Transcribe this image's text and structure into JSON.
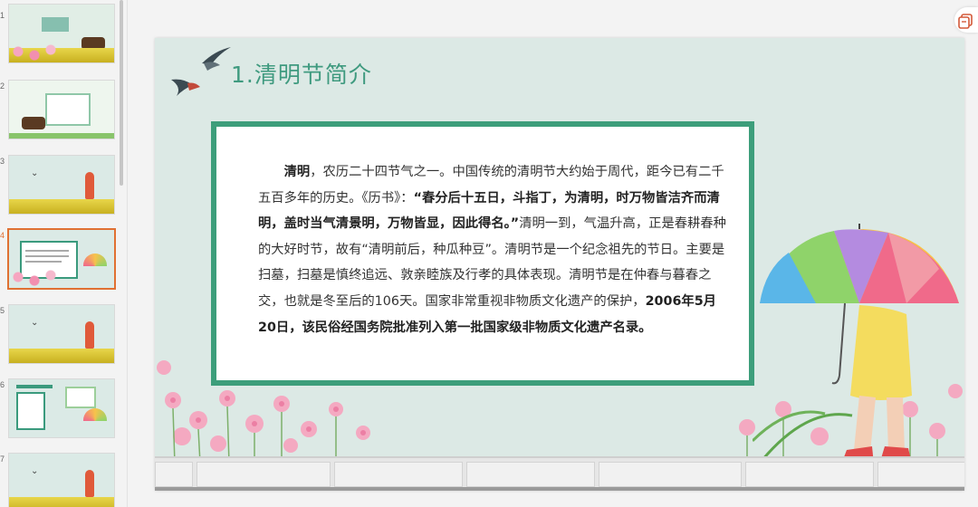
{
  "thumbnails": [
    {
      "num": "1",
      "selected": false
    },
    {
      "num": "2",
      "selected": false
    },
    {
      "num": "3",
      "selected": false
    },
    {
      "num": "4",
      "selected": true
    },
    {
      "num": "5",
      "selected": false
    },
    {
      "num": "6",
      "selected": false
    },
    {
      "num": "7",
      "selected": false
    }
  ],
  "slide": {
    "title": "1.清明节简介",
    "paragraph": {
      "p1_bold": "清明",
      "p1": "，农历二十四节气之一。中国传统的清明节大约始于周代，距今已有二千五百多年的历史。《历书》：",
      "p2_bold": "“春分后十五日，斗指丁，为清明，时万物皆洁齐而清明，盖时当气清景明，万物皆显，因此得名。”",
      "p3": "清明一到，气温升高，正是春耕春种的大好时节，故有“清明前后，种瓜种豆”。清明节是一个纪念祖先的节日。主要是扫墓，扫墓是慎终追远、敦亲睦族及行孝的具体表现。清明节是在仲春与暮春之交，也就是冬至后的106天。国家非常重视非物质文化遗产的保护，",
      "p4_bold": "2006年5月20日，该民俗经国务院批准列入第一批国家级非物质文化遗产名录。"
    }
  },
  "icons": {
    "tool": "slide-tool-icon",
    "bird": "swallow-icon",
    "umbrella": "umbrella-girl-illustration"
  },
  "colors": {
    "accent": "#3d9e7b",
    "slide_bg": "#dce9e5",
    "selected_border": "#e07032"
  }
}
